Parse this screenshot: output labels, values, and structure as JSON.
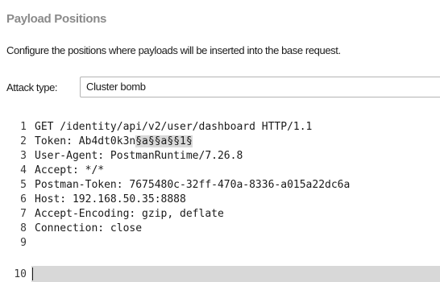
{
  "panel": {
    "title": "Payload Positions",
    "description": "Configure the positions where payloads will be inserted into the base request."
  },
  "attack_type": {
    "label": "Attack type:",
    "selected": "Cluster bomb"
  },
  "editor": {
    "line_numbers": [
      "1",
      "2",
      "3",
      "4",
      "5",
      "6",
      "7",
      "8",
      "9",
      "10"
    ],
    "lines": {
      "l1": "GET /identity/api/v2/user/dashboard HTTP/1.1",
      "l2_prefix": "Token: Ab4dt0k3n",
      "l2_marker1": "§a§",
      "l2_marker2": "§a§",
      "l2_marker3": "§1§",
      "l3": "User-Agent: PostmanRuntime/7.26.8",
      "l4": "Accept: */*",
      "l5": "Postman-Token: 7675480c-32ff-470a-8336-a015a22dc6a",
      "l6": "Host: 192.168.50.35:8888",
      "l7": "Accept-Encoding: gzip, deflate",
      "l8": "Connection: close",
      "l9": "",
      "l10": ""
    }
  }
}
